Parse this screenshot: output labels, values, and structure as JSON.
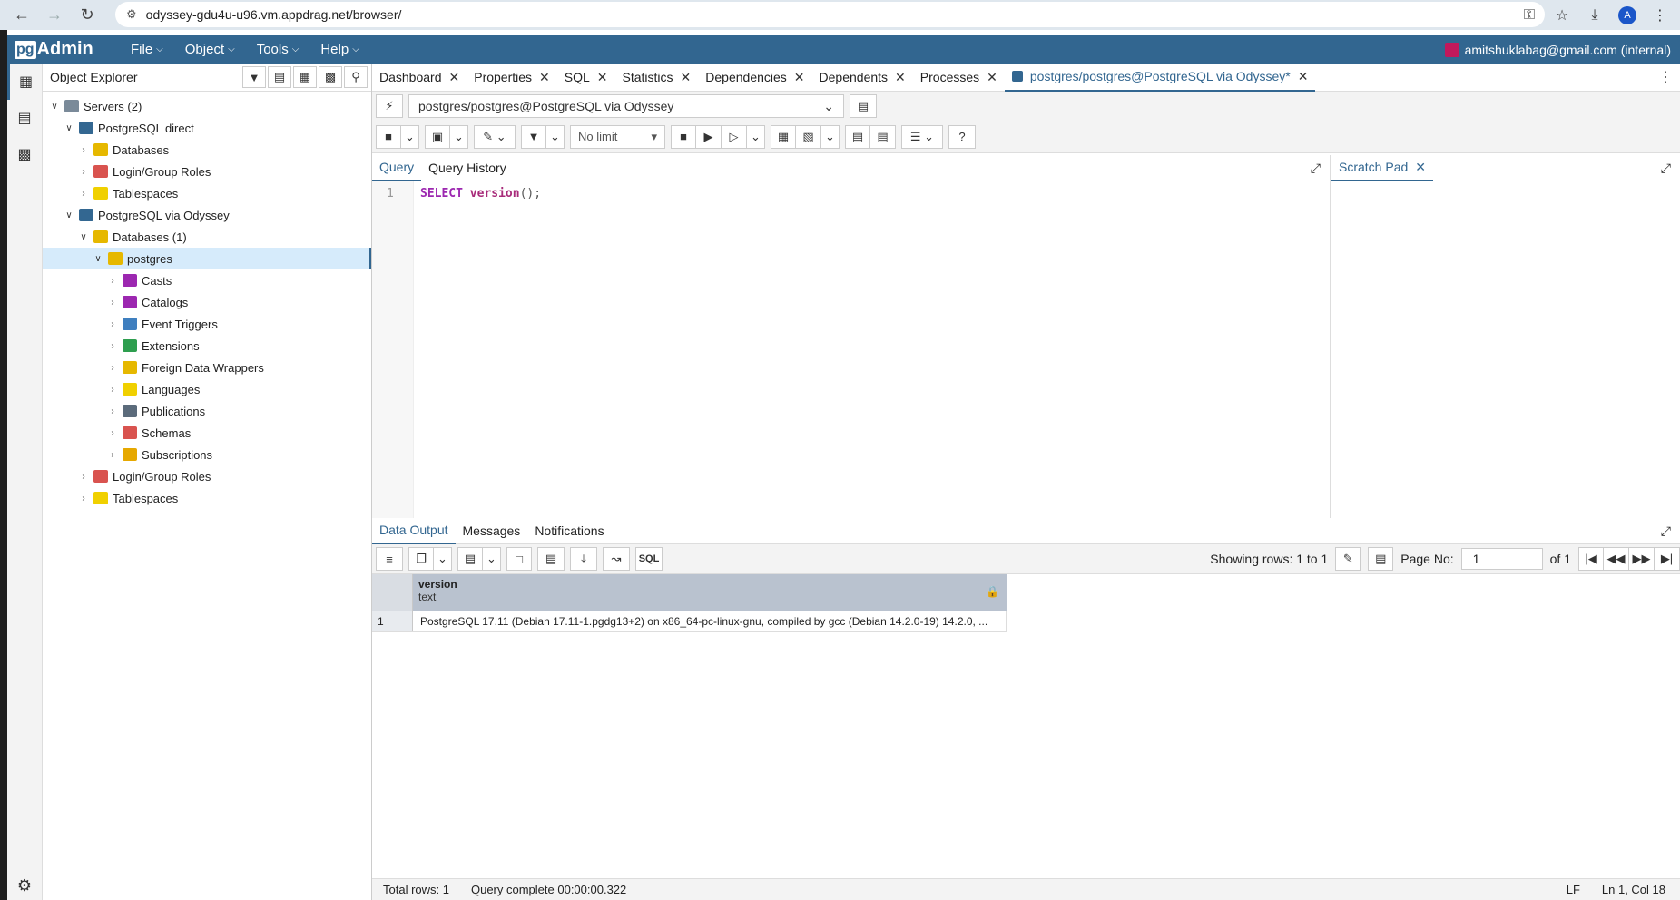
{
  "browser": {
    "url": "odyssey-gdu4u-u96.vm.appdrag.net/browser/",
    "profile_initial": "A"
  },
  "menubar": {
    "brand_pg": "pg",
    "brand_admin": "Admin",
    "items": [
      "File",
      "Object",
      "Tools",
      "Help"
    ],
    "user": "amitshuklabag@gmail.com (internal)"
  },
  "explorer": {
    "title": "Object Explorer",
    "tree": [
      {
        "label": "Servers (2)",
        "level": 0,
        "open": true,
        "color": "#7a8a99"
      },
      {
        "label": "PostgreSQL direct",
        "level": 1,
        "open": true,
        "color": "#336791"
      },
      {
        "label": "Databases",
        "level": 2,
        "open": false,
        "color": "#e6b800"
      },
      {
        "label": "Login/Group Roles",
        "level": 2,
        "open": false,
        "color": "#d9534f"
      },
      {
        "label": "Tablespaces",
        "level": 2,
        "open": false,
        "color": "#f0d000"
      },
      {
        "label": "PostgreSQL via Odyssey",
        "level": 1,
        "open": true,
        "color": "#336791"
      },
      {
        "label": "Databases (1)",
        "level": 2,
        "open": true,
        "color": "#e6b800"
      },
      {
        "label": "postgres",
        "level": 3,
        "open": true,
        "color": "#e6b800",
        "selected": true
      },
      {
        "label": "Casts",
        "level": 4,
        "open": false,
        "color": "#9c27b0"
      },
      {
        "label": "Catalogs",
        "level": 4,
        "open": false,
        "color": "#9c27b0"
      },
      {
        "label": "Event Triggers",
        "level": 4,
        "open": false,
        "color": "#3f7fbf"
      },
      {
        "label": "Extensions",
        "level": 4,
        "open": false,
        "color": "#2e9e4f"
      },
      {
        "label": "Foreign Data Wrappers",
        "level": 4,
        "open": false,
        "color": "#e6b800"
      },
      {
        "label": "Languages",
        "level": 4,
        "open": false,
        "color": "#f0d000"
      },
      {
        "label": "Publications",
        "level": 4,
        "open": false,
        "color": "#5b6b7b"
      },
      {
        "label": "Schemas",
        "level": 4,
        "open": false,
        "color": "#d9534f"
      },
      {
        "label": "Subscriptions",
        "level": 4,
        "open": false,
        "color": "#e6a800"
      },
      {
        "label": "Login/Group Roles",
        "level": 2,
        "open": false,
        "color": "#d9534f"
      },
      {
        "label": "Tablespaces",
        "level": 2,
        "open": false,
        "color": "#f0d000"
      }
    ]
  },
  "tabs": [
    {
      "label": "Dashboard"
    },
    {
      "label": "Properties"
    },
    {
      "label": "SQL"
    },
    {
      "label": "Statistics"
    },
    {
      "label": "Dependencies"
    },
    {
      "label": "Dependents"
    },
    {
      "label": "Processes"
    },
    {
      "label": "postgres/postgres@PostgreSQL via Odyssey*",
      "active": true
    }
  ],
  "connection": "postgres/postgres@PostgreSQL via Odyssey",
  "toolbar": {
    "limit": "No limit"
  },
  "query_tabs": [
    "Query",
    "Query History"
  ],
  "editor": {
    "line_number": "1",
    "kw": "SELECT",
    "fn": "version",
    "rest": "();"
  },
  "scratch_pad": "Scratch Pad",
  "result_tabs": [
    "Data Output",
    "Messages",
    "Notifications"
  ],
  "result_toolbar": {
    "sql_label": "SQL",
    "showing": "Showing rows: 1 to 1",
    "page_label": "Page No:",
    "page_value": "1",
    "page_of": "of 1"
  },
  "grid": {
    "column_name": "version",
    "column_type": "text",
    "rows": [
      {
        "num": "1",
        "value": "PostgreSQL 17.11 (Debian 17.11-1.pgdg13+2) on x86_64-pc-linux-gnu, compiled by gcc (Debian 14.2.0-19) 14.2.0, ..."
      }
    ]
  },
  "status": {
    "total_rows": "Total rows: 1",
    "query_complete": "Query complete 00:00:00.322",
    "line_ending": "LF",
    "cursor": "Ln 1, Col 18"
  }
}
